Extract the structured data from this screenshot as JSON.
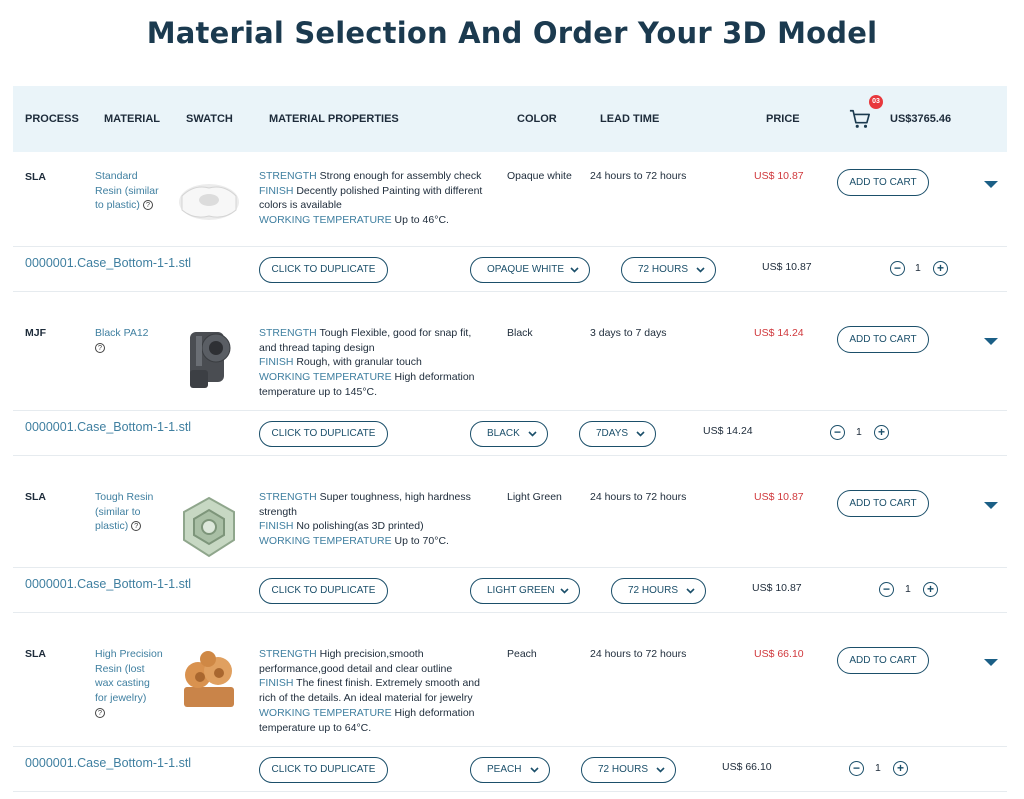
{
  "page": {
    "title": "Material Selection And Order Your 3D Model"
  },
  "header": {
    "process": "PROCESS",
    "material": "MATERIAL",
    "swatch": "SWATCH",
    "properties": "MATERIAL PROPERTIES",
    "color": "COLOR",
    "lead_time": "LEAD TIME",
    "price": "PRICE",
    "cart_badge": "03",
    "cart_total": "US$3765.46"
  },
  "labels": {
    "strength": "STRENGTH",
    "finish": "FINISH",
    "working_temperature": "WORKING TEMPERATURE",
    "help_icon": "?",
    "add_to_cart": "ADD TO CART",
    "duplicate": "CLICK TO DUPLICATE",
    "minus": "−",
    "plus": "+"
  },
  "materials": [
    {
      "process": "SLA",
      "material": "Standard Resin (similar to plastic)",
      "swatch_icon": "resin-part-white-icon",
      "strength": "Strong enough for assembly check",
      "finish": "Decently polished Painting with different colors is available",
      "working_temperature": "Up to 46°C.",
      "color": "Opaque white",
      "lead_time": "24 hours to 72 hours",
      "price": "US$ 10.87",
      "file": {
        "name": "0000001.Case_Bottom-1-1.stl",
        "color_select": "OPAQUE WHITE",
        "lead_select": "72 HOURS",
        "price": "US$ 10.87",
        "quantity": "1"
      }
    },
    {
      "process": "MJF",
      "material": "Black PA12",
      "swatch_icon": "black-pa12-part-icon",
      "strength": "Tough Flexible, good for snap fit, and thread taping design",
      "finish": "Rough, with granular touch",
      "working_temperature": "High deformation temperature up to 145°C.",
      "color": "Black",
      "lead_time": "3 days to 7 days",
      "price": "US$ 14.24",
      "file": {
        "name": "0000001.Case_Bottom-1-1.stl",
        "color_select": "BLACK",
        "lead_select": "7DAYS",
        "price": "US$ 14.24",
        "quantity": "1"
      }
    },
    {
      "process": "SLA",
      "material": "Tough Resin (similar to plastic)",
      "swatch_icon": "green-lattice-part-icon",
      "strength": "Super toughness, high hardness strength",
      "finish": "No polishing(as 3D printed)",
      "working_temperature": "Up to 70°C.",
      "color": "Light Green",
      "lead_time": "24 hours to 72 hours",
      "price": "US$ 10.87",
      "file": {
        "name": "0000001.Case_Bottom-1-1.stl",
        "color_select": "LIGHT GREEN",
        "lead_select": "72 HOURS",
        "price": "US$ 10.87",
        "quantity": "1"
      }
    },
    {
      "process": "SLA",
      "material": "High Precision Resin (lost wax casting for jewelry)",
      "swatch_icon": "peach-casting-part-icon",
      "strength": "High precision,smooth performance,good detail and clear outline",
      "finish": "The finest finish. Extremely smooth and rich of the details. An ideal material for jewelry",
      "working_temperature": "High deformation temperature up to 64°C.",
      "color": "Peach",
      "lead_time": "24 hours to 72 hours",
      "price": "US$ 66.10",
      "file": {
        "name": "0000001.Case_Bottom-1-1.stl",
        "color_select": "PEACH",
        "lead_select": "72 HOURS",
        "price": "US$ 66.10",
        "quantity": "1"
      }
    }
  ]
}
